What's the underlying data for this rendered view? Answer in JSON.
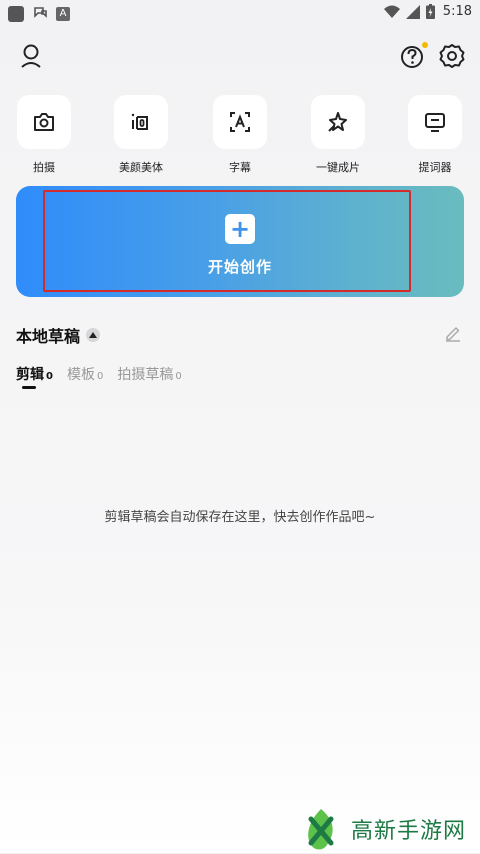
{
  "status_bar": {
    "time": "5:18",
    "keyboard_indicator": "A"
  },
  "header": {
    "profile_icon": "person-icon",
    "help_icon": "question-circle-icon",
    "settings_icon": "gear-icon",
    "notification_dot_color": "#f5b800"
  },
  "tools": [
    {
      "label": "拍摄",
      "icon": "camera-icon"
    },
    {
      "label": "美颜美体",
      "icon": "beauty-icon"
    },
    {
      "label": "字幕",
      "icon": "subtitle-icon"
    },
    {
      "label": "一键成片",
      "icon": "magic-star-icon"
    },
    {
      "label": "提词器",
      "icon": "teleprompter-icon"
    }
  ],
  "create": {
    "label": "开始创作",
    "plus": "+"
  },
  "drafts": {
    "title": "本地草稿",
    "tabs": [
      {
        "label": "剪辑",
        "count": "0",
        "active": true
      },
      {
        "label": "模板",
        "count": "0",
        "active": false
      },
      {
        "label": "拍摄草稿",
        "count": "0",
        "active": false
      }
    ],
    "empty_message": "剪辑草稿会自动保存在这里，快去创作作品吧~"
  },
  "watermark": {
    "text": "高新手游网"
  },
  "colors": {
    "create_gradient_start": "#2f8cfb",
    "create_gradient_end": "#69bcbe",
    "highlight_border": "#d42a2a",
    "watermark_green": "#1e7a45"
  }
}
